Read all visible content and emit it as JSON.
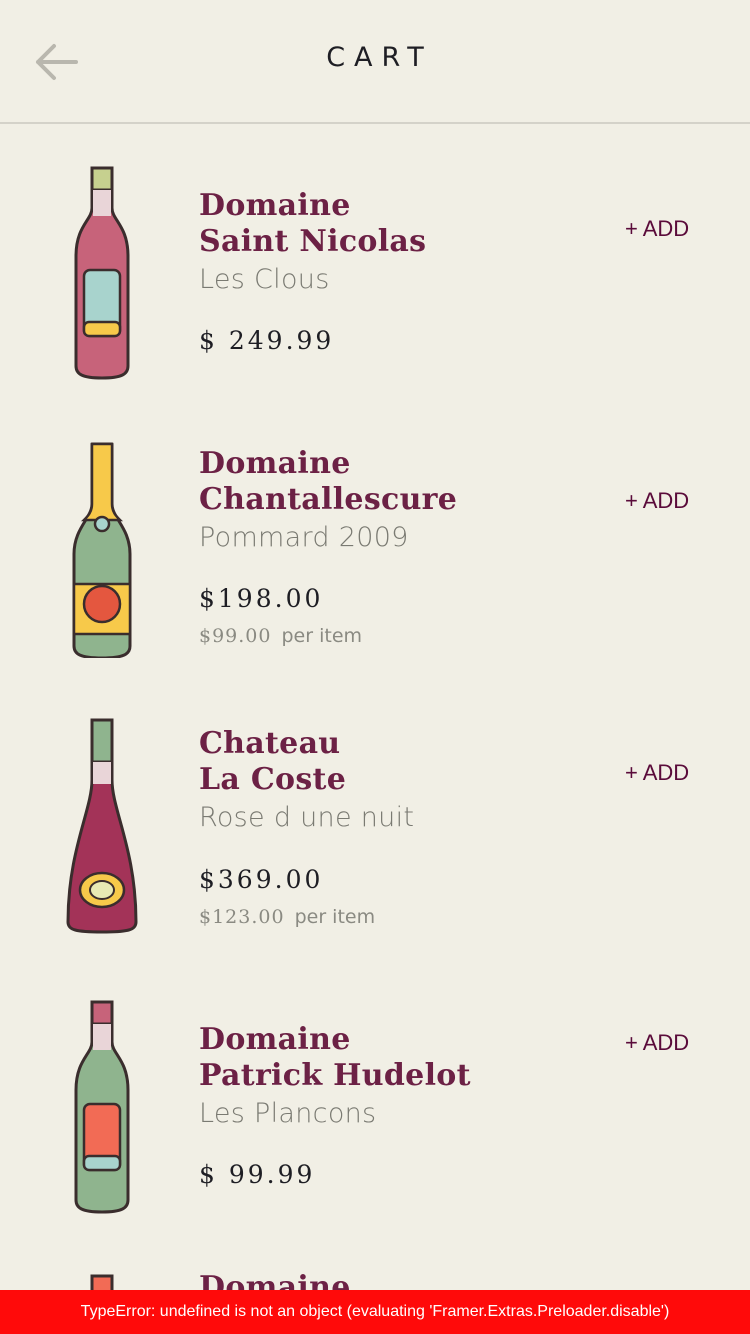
{
  "header": {
    "title": "CART",
    "back_icon": "arrow-left-icon"
  },
  "items": [
    {
      "winery_line1": "Domaine",
      "winery_line2": "Saint Nicolas",
      "wine": "Les Clous",
      "price": "$ 249.99",
      "unit_price": "",
      "per_item": "",
      "add_label": "+ ADD",
      "bottle_icon": "rose-wine-bottle-icon"
    },
    {
      "winery_line1": "Domaine",
      "winery_line2": "Chantallescure",
      "wine": "Pommard 2009",
      "price": "$198.00",
      "unit_price": "$99.00",
      "per_item": "per item",
      "add_label": "+ ADD",
      "bottle_icon": "champagne-bottle-icon"
    },
    {
      "winery_line1": "Chateau",
      "winery_line2": "La Coste",
      "wine": "Rose d une nuit",
      "price": "$369.00",
      "unit_price": "$123.00",
      "per_item": "per item",
      "add_label": "+ ADD",
      "bottle_icon": "red-wine-bottle-icon"
    },
    {
      "winery_line1": "Domaine",
      "winery_line2": "Patrick Hudelot",
      "wine": "Les Plancons",
      "price": "$ 99.99",
      "unit_price": "",
      "per_item": "",
      "add_label": "+ ADD",
      "bottle_icon": "green-wine-bottle-icon"
    },
    {
      "winery_line1": "Domaine",
      "bottle_icon": "wine-bottle-icon"
    }
  ],
  "error": {
    "message": "TypeError: undefined is not an object (evaluating 'Framer.Extras.Preloader.disable')"
  }
}
